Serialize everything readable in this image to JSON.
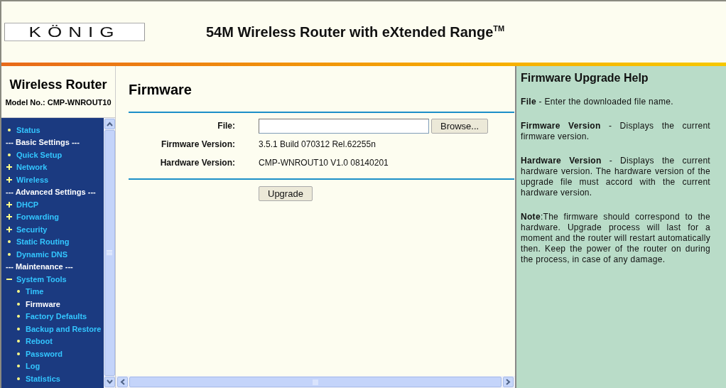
{
  "header": {
    "logo": "KÖNIG",
    "title": "54M Wireless Router with eXtended Range$^{TM}$"
  },
  "sidebar": {
    "title": "Wireless Router",
    "model": "Model No.: CMP-WNROUT10",
    "menu": [
      {
        "kind": "link",
        "label": "Status",
        "selected": false
      },
      {
        "kind": "header",
        "label": "--- Basic Settings ---"
      },
      {
        "kind": "link",
        "label": "Quick Setup",
        "selected": false
      },
      {
        "kind": "group",
        "label": "Network",
        "expanded": false,
        "selected": false
      },
      {
        "kind": "group",
        "label": "Wireless",
        "expanded": false,
        "selected": false
      },
      {
        "kind": "header",
        "label": "--- Advanced Settings ---"
      },
      {
        "kind": "group",
        "label": "DHCP",
        "expanded": false,
        "selected": false
      },
      {
        "kind": "group",
        "label": "Forwarding",
        "expanded": false,
        "selected": false
      },
      {
        "kind": "group",
        "label": "Security",
        "expanded": false,
        "selected": false
      },
      {
        "kind": "link",
        "label": "Static Routing",
        "selected": false
      },
      {
        "kind": "link",
        "label": "Dynamic DNS",
        "selected": false
      },
      {
        "kind": "header",
        "label": "--- Maintenance ---"
      },
      {
        "kind": "group",
        "label": "System Tools",
        "expanded": true,
        "selected": false,
        "children": [
          {
            "kind": "link",
            "label": "Time",
            "selected": false
          },
          {
            "kind": "link",
            "label": "Firmware",
            "selected": true
          },
          {
            "kind": "link",
            "label": "Factory Defaults",
            "selected": false
          },
          {
            "kind": "link",
            "label": "Backup and Restore",
            "selected": false
          },
          {
            "kind": "link",
            "label": "Reboot",
            "selected": false
          },
          {
            "kind": "link",
            "label": "Password",
            "selected": false
          },
          {
            "kind": "link",
            "label": "Log",
            "selected": false
          },
          {
            "kind": "link",
            "label": "Statistics",
            "selected": false
          }
        ]
      }
    ]
  },
  "page": {
    "title": "Firmware",
    "fields": [
      {
        "kind": "file",
        "label": "File:",
        "button": "Browse..."
      },
      {
        "kind": "text",
        "label": "Firmware Version:",
        "value": "3.5.1 Build 070312 Rel.62255n"
      },
      {
        "kind": "text",
        "label": "Hardware Version:",
        "value": "CMP-WNROUT10 V1.0 08140201"
      }
    ],
    "action": "Upgrade"
  },
  "help": {
    "title": "Firmware Upgrade Help",
    "paragraphs": [
      "**File** - Enter the downloaded file name.",
      "**Firmware Version** - Displays the current firmware version.",
      "**Hardware Version** - Displays the current hardware version. The hardware version of the upgrade file must accord with the current hardware version.",
      "**Note**:The firmware should correspond to the hardware. Upgrade process will last for a moment and the router will restart automatically then. Keep the power of the router on during the process, in case of any damage."
    ]
  }
}
